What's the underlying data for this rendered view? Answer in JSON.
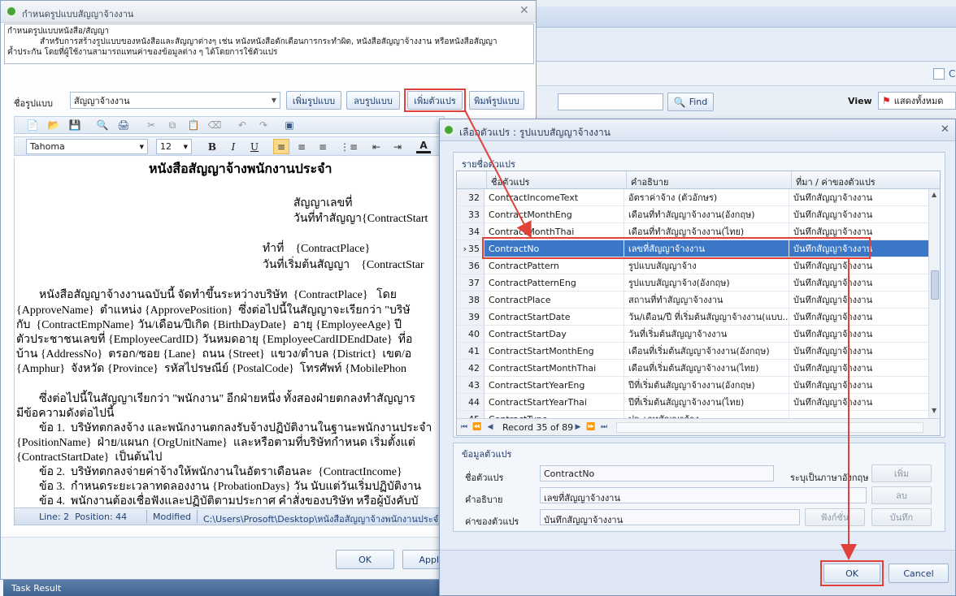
{
  "bg": {
    "c_text": "C",
    "find_label": "Find",
    "view_label": "View",
    "view_value": "แสดงทั้งหมด",
    "task_result": "Task Result"
  },
  "main": {
    "title": "กำหนดรูปแบบสัญญาจ้างงาน",
    "desc_title": "กำหนดรูปแบบหนังสือ/สัญญา",
    "desc_line1": "สำหรับการสร้างรูปแบบของหนังสือและสัญญาต่างๆ เช่น หนังหนังสือตักเตือนการกระทำผิด, หนังสือสัญญาจ้างงาน หรือหนังสือสัญญา",
    "desc_line2": "ค้ำประกัน โดยที่ผู้ใช้งานสามารถแทนค่าของข้อมูลต่าง ๆ ได้โดยการใช้ตัวแปร",
    "name_label": "ชื่อรูปแบบ",
    "name_value": "สัญญาจ้างงาน",
    "btn_add": "เพิ่มรูปแบบ",
    "btn_del": "ลบรูปแบบ",
    "btn_addvar": "เพิ่มตัวแปร",
    "btn_print": "พิมพ์รูปแบบ",
    "font_name": "Tahoma",
    "font_size": "12",
    "toolbar_bold": "B",
    "toolbar_italic": "I",
    "toolbar_underline": "U",
    "toolbar_fontcolor": "A",
    "status_line": "Line: 2  Position: 44",
    "status_mod": "Modified",
    "status_path": "C:\\Users\\Prosoft\\Desktop\\หนังสือสัญญาจ้างพนักงานประจำ.r",
    "ok": "OK",
    "apply": "Apply"
  },
  "doc": {
    "title": "หนังสือสัญญาจ้างพนักงานประจำ",
    "l1": "สัญญาเลขที่",
    "l2": "วันที่ทำสัญญา{ContractStart",
    "l3": "ทำที่    {ContractPlace}",
    "l4": "วันที่เริ่มต้นสัญญา    {ContractStar",
    "p1": "        หนังสือสัญญาจ้างงานฉบับนี้ จัดทำขึ้นระหว่างบริษัท  {ContractPlace}   โดย",
    "p2": "{ApproveName}  ตำแหน่ง {ApprovePosition}  ซึ่งต่อไปนี้ในสัญญาจะเรียกว่า \"บริษั",
    "p3": "กับ  {ContractEmpName} วัน/เดือน/ปีเกิด {BirthDayDate}  อายุ {EmployeeAge} ปี",
    "p4": "ตัวประชาชนเลขที่ {EmployeeCardID} วันหมดอายุ {EmployeeCardIDEndDate}  ที่อ",
    "p5": "บ้าน {AddressNo}  ตรอก/ซอย {Lane}  ถนน {Street}  แขวง/ตำบล {District}  เขต/อ",
    "p6": "{Amphur}  จังหวัด {Province}  รหัสไปรษณีย์ {PostalCode}  โทรศัพท์ {MobilePhon",
    "p7": "        ซึ่งต่อไปนี้ในสัญญาเรียกว่า \"พนักงาน\" อีกฝ่ายหนึ่ง ทั้งสองฝ่ายตกลงทำสัญญาร",
    "p8": "มีข้อความดังต่อไปนี้",
    "p9": "        ข้อ 1.  บริษัทตกลงจ้าง และพนักงานตกลงรับจ้างปฏิบัติงานในฐานะพนักงานประจำ",
    "p10": "{PositionName}  ฝ่าย/แผนก {OrgUnitName}  และหรือตามที่บริษัทกำหนด เริ่มตั้งแต่",
    "p11": "{ContractStartDate}  เป็นต้นไป",
    "p12": "        ข้อ 2.  บริษัทตกลงจ่ายค่าจ้างให้พนักงานในอัตราเดือนละ  {ContractIncome}",
    "p13": "        ข้อ 3.  กำหนดระยะเวลาทดลองงาน {ProbationDays} วัน นับแต่วันเริ่มปฏิบัติงาน",
    "p14": "        ข้อ 4.  พนักงานต้องเชื่อฟังและปฏิบัติตามประกาศ คำสั่งของบริษัท หรือผู้บังคับบั"
  },
  "dialog": {
    "title": "เลือกตัวแปร : รูปแบบสัญญาจ้างงาน",
    "list_section": "รายชื่อตัวแปร",
    "col_name": "ชื่อตัวแปร",
    "col_desc": "คำอธิบาย",
    "col_source": "ที่มา / ค่าของตัวแปร",
    "rows": [
      {
        "n": "32",
        "name": "ContractIncomeText",
        "desc": "อัตราค่าจ้าง (ตัวอักษร)",
        "src": "บันทึกสัญญาจ้างงาน"
      },
      {
        "n": "33",
        "name": "ContractMonthEng",
        "desc": "เดือนที่ทำสัญญาจ้างงาน(อังกฤษ)",
        "src": "บันทึกสัญญาจ้างงาน"
      },
      {
        "n": "34",
        "name": "ContractMonthThai",
        "desc": "เดือนที่ทำสัญญาจ้างงาน(ไทย)",
        "src": "บันทึกสัญญาจ้างงาน"
      },
      {
        "n": "35",
        "name": "ContractNo",
        "desc": "เลขที่สัญญาจ้างงาน",
        "src": "บันทึกสัญญาจ้างงาน"
      },
      {
        "n": "36",
        "name": "ContractPattern",
        "desc": "รูปแบบสัญญาจ้าง",
        "src": "บันทึกสัญญาจ้างงาน"
      },
      {
        "n": "37",
        "name": "ContractPatternEng",
        "desc": "รูปแบบสัญญาจ้าง(อังกฤษ)",
        "src": "บันทึกสัญญาจ้างงาน"
      },
      {
        "n": "38",
        "name": "ContractPlace",
        "desc": "สถานที่ทำสัญญาจ้างงาน",
        "src": "บันทึกสัญญาจ้างงาน"
      },
      {
        "n": "39",
        "name": "ContractStartDate",
        "desc": "วัน/เดือน/ปี ที่เริ่มต้นสัญญาจ้างงาน(แบบ...",
        "src": "บันทึกสัญญาจ้างงาน"
      },
      {
        "n": "40",
        "name": "ContractStartDay",
        "desc": "วันที่เริ่มต้นสัญญาจ้างงาน",
        "src": "บันทึกสัญญาจ้างงาน"
      },
      {
        "n": "41",
        "name": "ContractStartMonthEng",
        "desc": "เดือนที่เริ่มต้นสัญญาจ้างงาน(อังกฤษ)",
        "src": "บันทึกสัญญาจ้างงาน"
      },
      {
        "n": "42",
        "name": "ContractStartMonthThai",
        "desc": "เดือนที่เริ่มต้นสัญญาจ้างงาน(ไทย)",
        "src": "บันทึกสัญญาจ้างงาน"
      },
      {
        "n": "43",
        "name": "ContractStartYearEng",
        "desc": "ปีที่เริ่มต้นสัญญาจ้างงาน(อังกฤษ)",
        "src": "บันทึกสัญญาจ้างงาน"
      },
      {
        "n": "44",
        "name": "ContractStartYearThai",
        "desc": "ปีที่เริ่มต้นสัญญาจ้างงาน(ไทย)",
        "src": "บันทึกสัญญาจ้างงาน"
      },
      {
        "n": "45",
        "name": "ContractType",
        "desc": "ประเภทสัญญาจ้าง",
        "src": ""
      }
    ],
    "selected_row": 3,
    "record_text": "Record 35 of 89",
    "info_section": "ข้อมูลตัวแปร",
    "lbl_name": "ชื่อตัวแปร",
    "val_name": "ContractNo",
    "lbl_en": "ระบุเป็นภาษาอังกฤษ",
    "lbl_desc": "คำอธิบาย",
    "val_desc": "เลขที่สัญญาจ้างงาน",
    "lbl_value": "ค่าของตัวแปร",
    "val_value": "บันทึกสัญญาจ้างงาน",
    "btn_add": "เพิ่ม",
    "btn_del": "ลบ",
    "btn_func": "ฟังก์ชั่น",
    "btn_save": "บันทึก",
    "ok": "OK",
    "cancel": "Cancel"
  }
}
